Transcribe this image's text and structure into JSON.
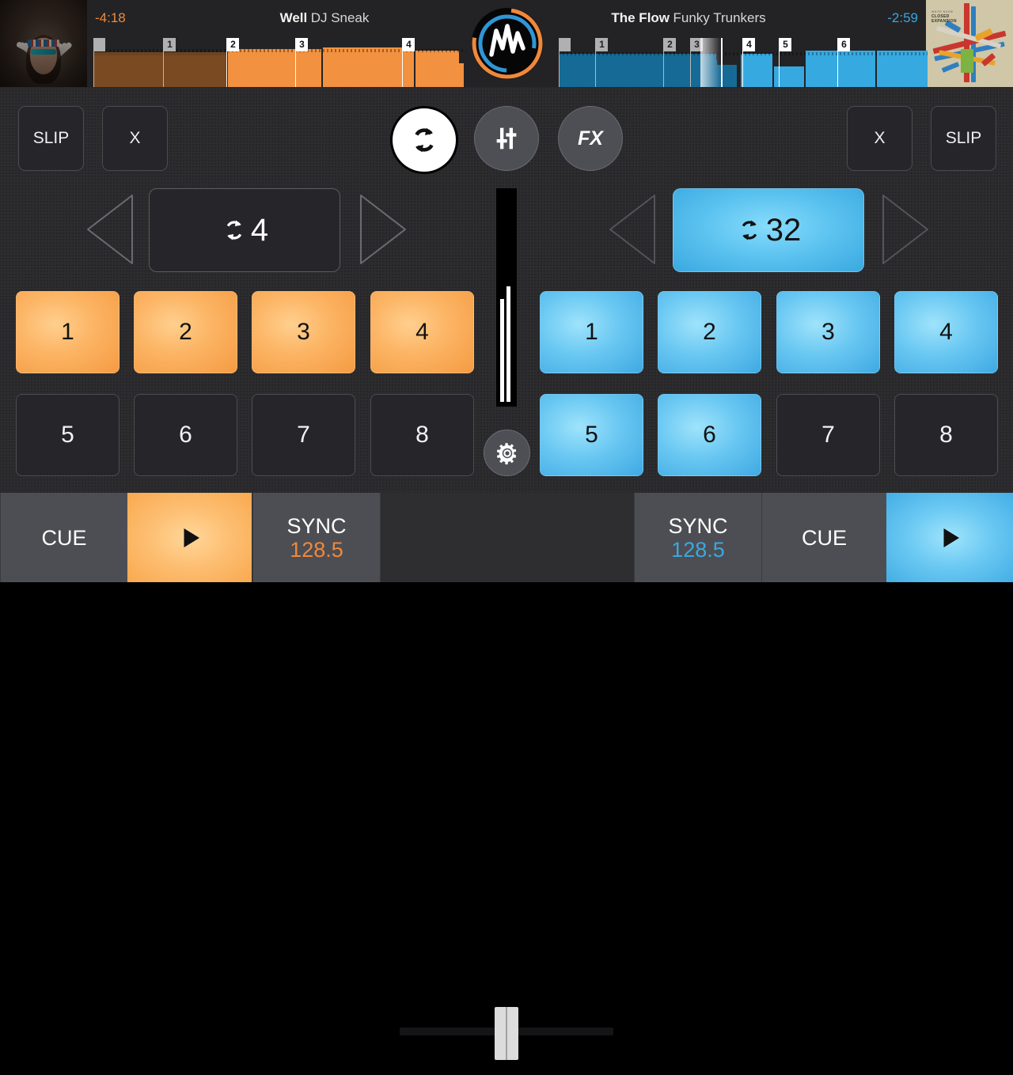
{
  "decks": {
    "left": {
      "track_title": "Well",
      "track_artist": "DJ Sneak",
      "time_remaining": "-4:18",
      "accent_color": "#f0883c",
      "slip_label": "SLIP",
      "x_label": "X",
      "loop_length": "4",
      "loop_active": false,
      "cue_label": "CUE",
      "sync_label": "SYNC",
      "bpm": "128.5",
      "play_icon": "play-icon",
      "album_art": "native-headdress-portrait",
      "pads": [
        {
          "label": "1",
          "lit": true
        },
        {
          "label": "2",
          "lit": true
        },
        {
          "label": "3",
          "lit": true
        },
        {
          "label": "4",
          "lit": true
        },
        {
          "label": "5",
          "lit": false
        },
        {
          "label": "6",
          "lit": false
        },
        {
          "label": "7",
          "lit": false
        },
        {
          "label": "8",
          "lit": false
        }
      ],
      "waveform_markers": [
        "1",
        "2",
        "3",
        "4"
      ]
    },
    "right": {
      "track_title": "The Flow",
      "track_artist": "Funky Trunkers",
      "time_remaining": "-2:59",
      "accent_color": "#3aa8e0",
      "slip_label": "SLIP",
      "x_label": "X",
      "loop_length": "32",
      "loop_active": true,
      "cue_label": "CUE",
      "sync_label": "SYNC",
      "bpm": "128.5",
      "play_icon": "play-icon",
      "album_art": "closed-expansion-cover",
      "album_art_title": "CLOSED",
      "album_art_title2": "EXPANSION",
      "album_art_sub": "WHITE NOISE",
      "pads": [
        {
          "label": "1",
          "lit": true
        },
        {
          "label": "2",
          "lit": true
        },
        {
          "label": "3",
          "lit": true
        },
        {
          "label": "4",
          "lit": true
        },
        {
          "label": "5",
          "lit": true
        },
        {
          "label": "6",
          "lit": true
        },
        {
          "label": "7",
          "lit": false
        },
        {
          "label": "8",
          "lit": false
        }
      ],
      "waveform_markers": [
        "1",
        "2",
        "3",
        "4",
        "5",
        "6"
      ]
    }
  },
  "center": {
    "logo_name": "waveform-logo",
    "loop_button": "loop-toggle-icon",
    "mixer_button": "mixer-sliders-icon",
    "fx_button_label": "FX",
    "settings_button": "gear-icon",
    "crossfader_position": "center",
    "level_meter": "master-level-meter"
  }
}
